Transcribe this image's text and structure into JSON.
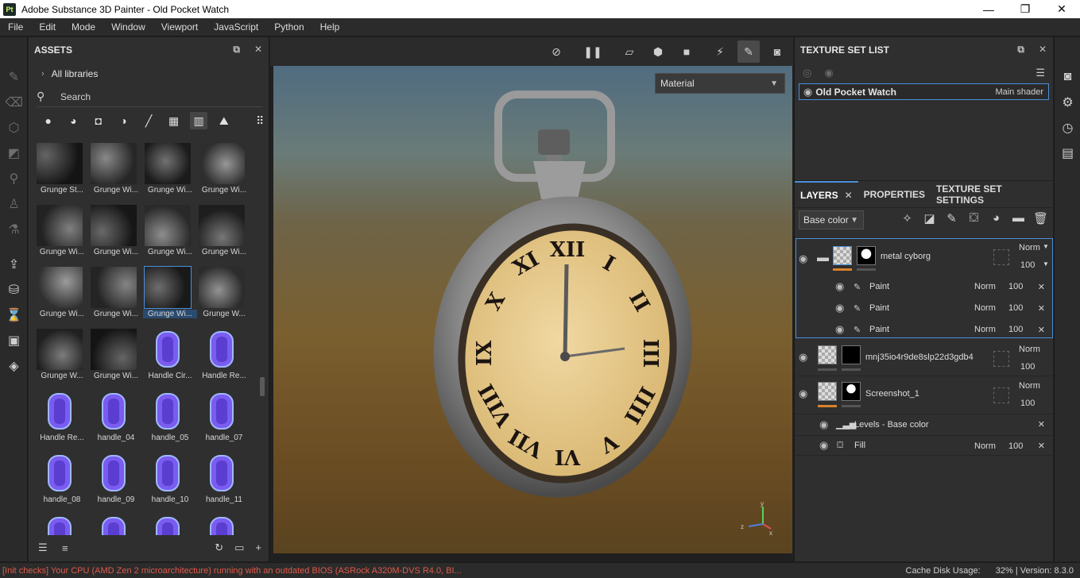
{
  "window": {
    "title": "Adobe Substance 3D Painter - Old Pocket Watch",
    "app_icon_text": "Pt",
    "controls": [
      "—",
      "❐",
      "✕"
    ]
  },
  "menu": [
    "File",
    "Edit",
    "Mode",
    "Window",
    "Viewport",
    "JavaScript",
    "Python",
    "Help"
  ],
  "assets": {
    "title": "ASSETS",
    "library": "All libraries",
    "search_placeholder": "Search",
    "items": [
      {
        "label": "Grunge St...",
        "kind": "texture"
      },
      {
        "label": "Grunge Wi...",
        "kind": "texture"
      },
      {
        "label": "Grunge Wi...",
        "kind": "texture"
      },
      {
        "label": "Grunge Wi...",
        "kind": "texture"
      },
      {
        "label": "Grunge Wi...",
        "kind": "texture"
      },
      {
        "label": "Grunge Wi...",
        "kind": "texture"
      },
      {
        "label": "Grunge Wi...",
        "kind": "texture"
      },
      {
        "label": "Grunge Wi...",
        "kind": "texture"
      },
      {
        "label": "Grunge Wi...",
        "kind": "texture"
      },
      {
        "label": "Grunge Wi...",
        "kind": "texture"
      },
      {
        "label": "Grunge Wi...",
        "kind": "texture",
        "selected": true
      },
      {
        "label": "Grunge W...",
        "kind": "texture"
      },
      {
        "label": "Grunge W...",
        "kind": "texture"
      },
      {
        "label": "Grunge Wi...",
        "kind": "texture"
      },
      {
        "label": "Handle Cir...",
        "kind": "handle"
      },
      {
        "label": "Handle Re...",
        "kind": "handle"
      },
      {
        "label": "Handle Re...",
        "kind": "handle"
      },
      {
        "label": "handle_04",
        "kind": "handle"
      },
      {
        "label": "handle_05",
        "kind": "handle"
      },
      {
        "label": "handle_07",
        "kind": "handle"
      },
      {
        "label": "handle_08",
        "kind": "handle"
      },
      {
        "label": "handle_09",
        "kind": "handle"
      },
      {
        "label": "handle_10",
        "kind": "handle"
      },
      {
        "label": "handle_11",
        "kind": "handle"
      },
      {
        "label": "",
        "kind": "handle"
      },
      {
        "label": "",
        "kind": "handle"
      },
      {
        "label": "",
        "kind": "handle"
      },
      {
        "label": "",
        "kind": "handle"
      }
    ]
  },
  "viewport": {
    "mode_dropdown": "Material",
    "axis": {
      "x": "x",
      "y": "y",
      "z": "z"
    }
  },
  "texture_set_list": {
    "title": "TEXTURE SET LIST",
    "set_name": "Old Pocket Watch",
    "shader": "Main shader"
  },
  "layers_panel": {
    "tabs": [
      "LAYERS",
      "PROPERTIES",
      "TEXTURE SET SETTINGS"
    ],
    "channel": "Base color",
    "layers": [
      {
        "name": "metal cyborg",
        "blend": "Norm",
        "opacity": "100"
      },
      {
        "name": "Paint",
        "blend": "Norm",
        "opacity": "100"
      },
      {
        "name": "Paint",
        "blend": "Norm",
        "opacity": "100"
      },
      {
        "name": "Paint",
        "blend": "Norm",
        "opacity": "100"
      },
      {
        "name": "mnj35io4r9de8slp22d3gdb4",
        "blend": "Norm",
        "opacity": "100"
      },
      {
        "name": "Screenshot_1",
        "blend": "Norm",
        "opacity": "100"
      },
      {
        "name": "Levels - Base color"
      },
      {
        "name": "Fill",
        "blend": "Norm",
        "opacity": "100"
      }
    ]
  },
  "status": {
    "message": "[Init checks] Your CPU (AMD Zen 2 microarchitecture) running with an outdated BIOS (ASRock A320M-DVS R4.0, BI...",
    "cache_label": "Cache Disk Usage:",
    "cache_value": "32%",
    "version": "| Version: 8.3.0"
  },
  "colors": {
    "accent": "#4a90d9",
    "error": "#e05a4a",
    "handle": "#7a5cf0"
  }
}
